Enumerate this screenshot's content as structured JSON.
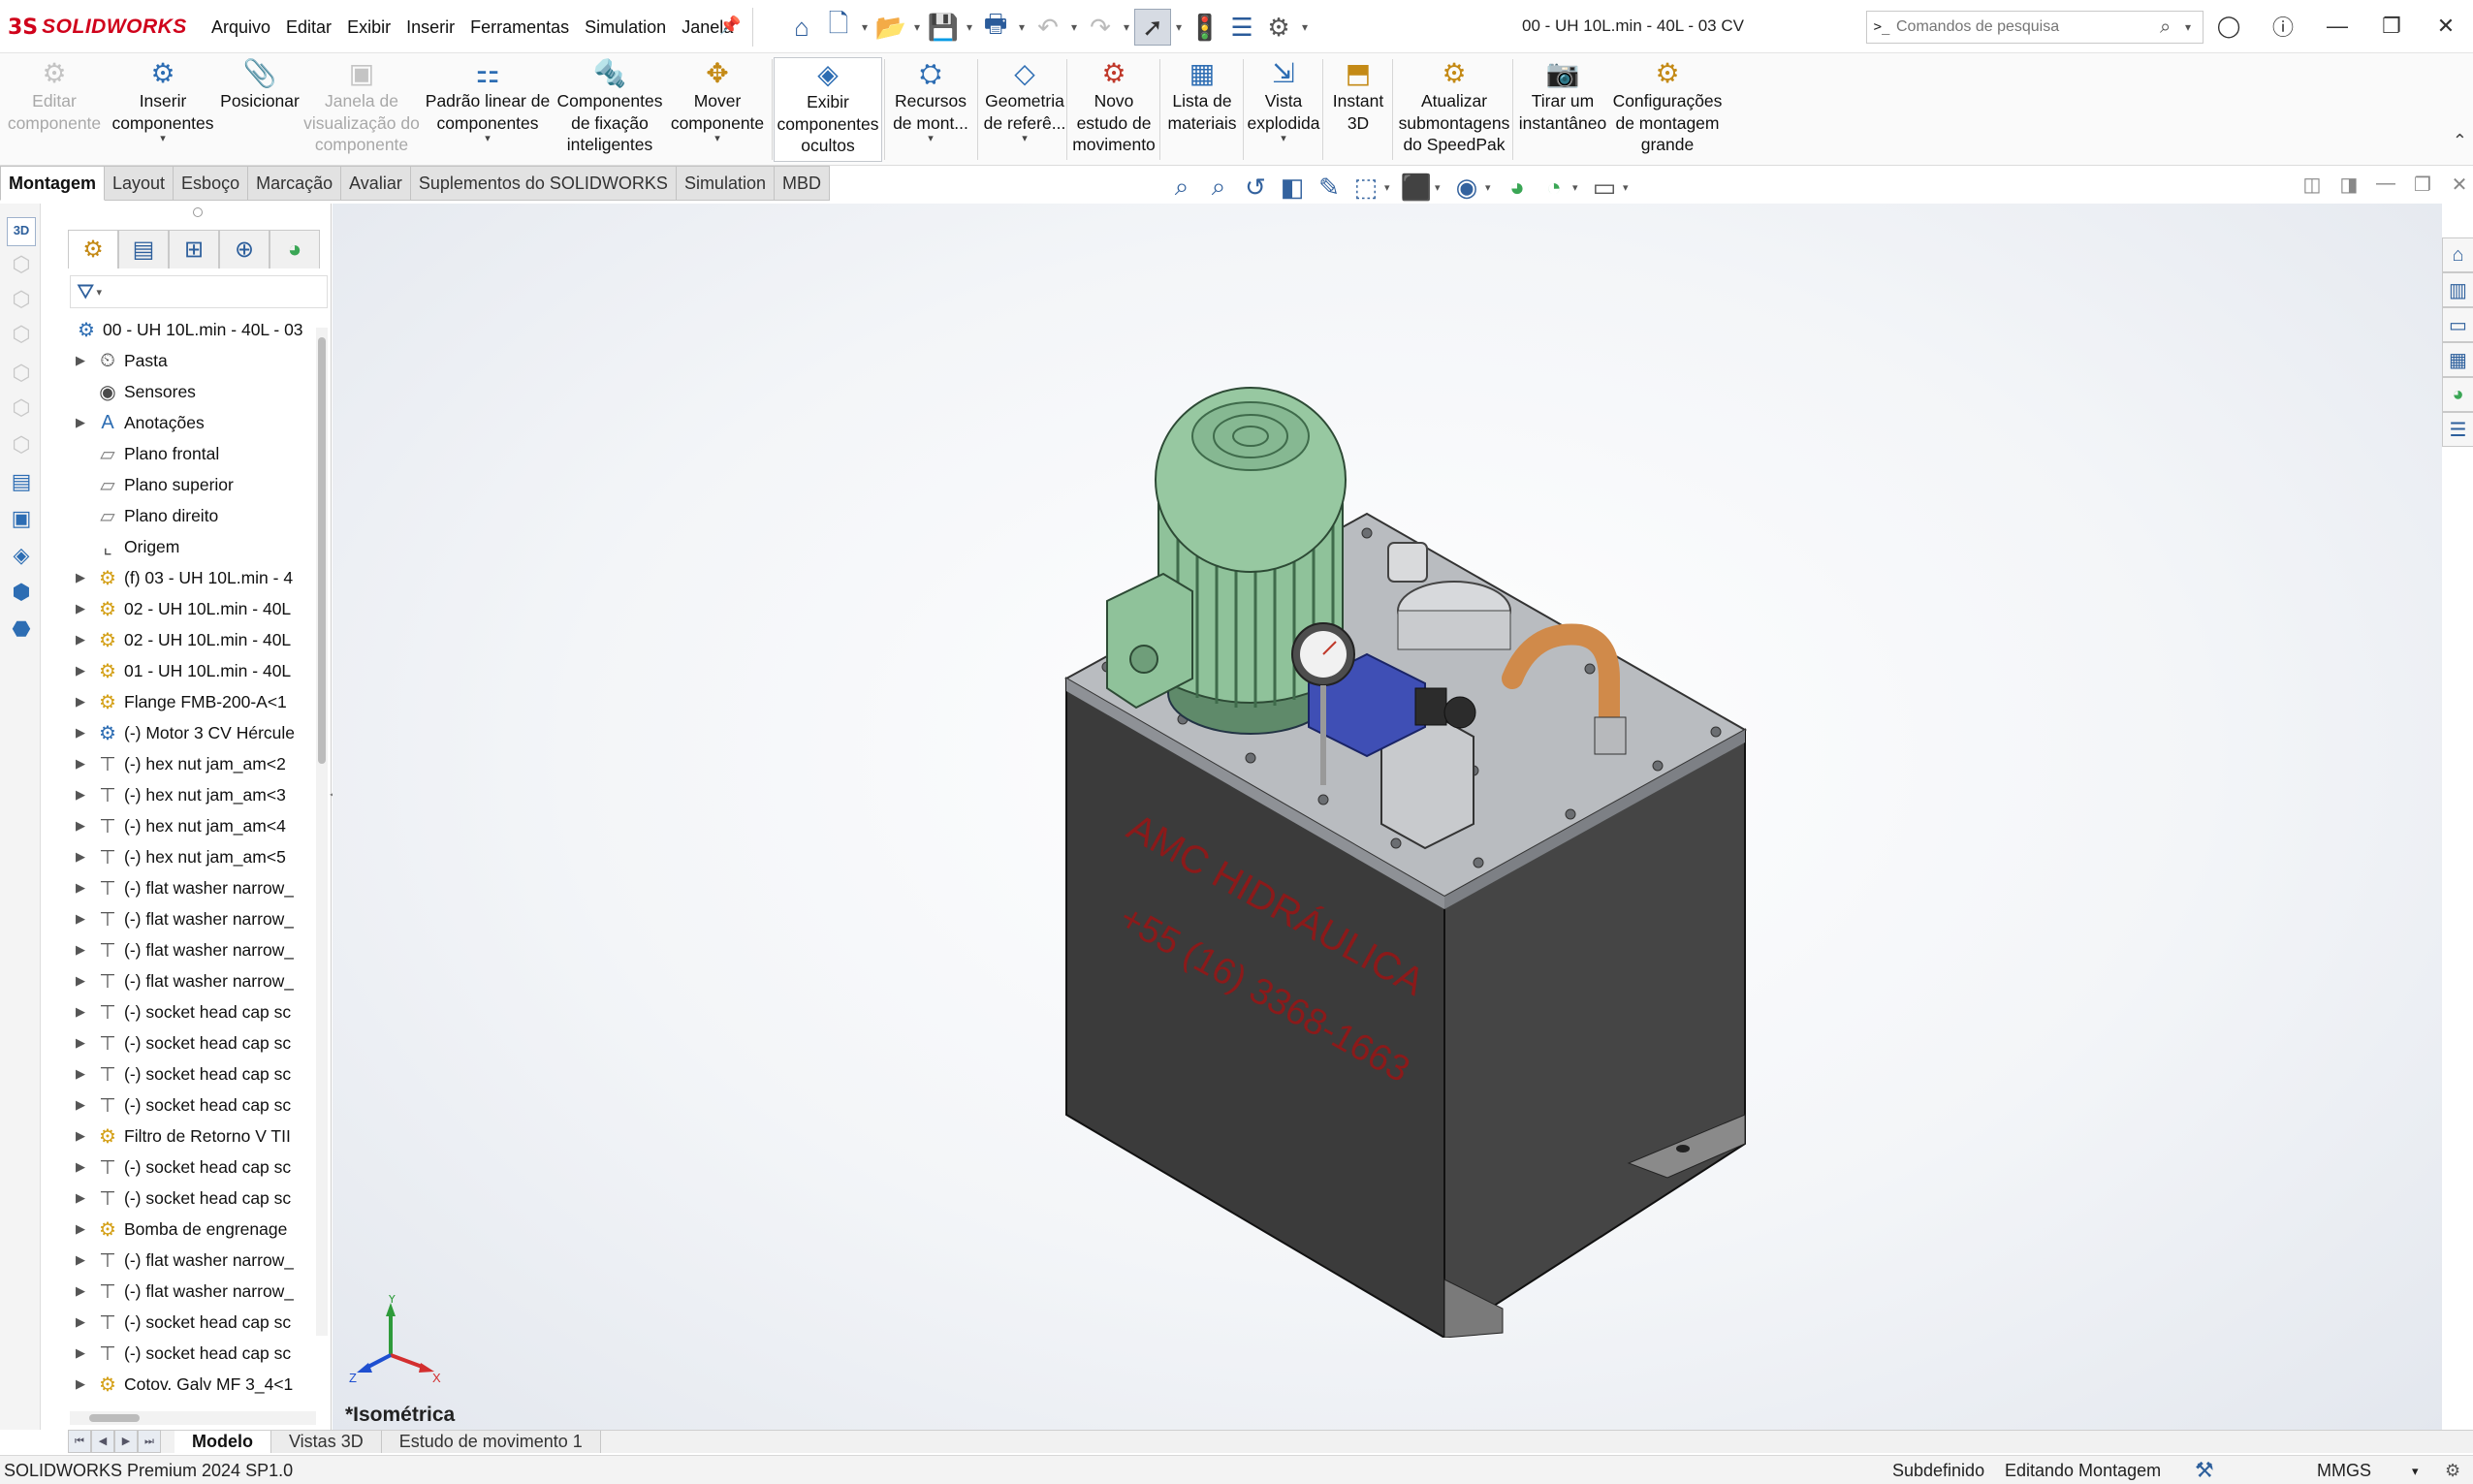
{
  "app": {
    "brand_prefix": "3S",
    "brand": "SOLIDWORKS",
    "document_title": "00 - UH 10L.min - 40L - 03 CV"
  },
  "menu": [
    "Arquivo",
    "Editar",
    "Exibir",
    "Inserir",
    "Ferramentas",
    "Simulation",
    "Janela"
  ],
  "search": {
    "placeholder": "Comandos de pesquisa",
    "prompt_glyph": ">_"
  },
  "ribbon": [
    {
      "lines": [
        "Editar",
        "componente"
      ],
      "enabled": false,
      "icon": "edit-component-icon"
    },
    {
      "lines": [
        "Inserir",
        "componentes"
      ],
      "enabled": true,
      "dropdown": true,
      "icon": "insert-components-icon"
    },
    {
      "lines": [
        "Posicionar"
      ],
      "enabled": true,
      "icon": "mate-icon"
    },
    {
      "lines": [
        "Janela de",
        "visualização do",
        "componente"
      ],
      "enabled": false,
      "icon": "component-preview-window-icon"
    },
    {
      "lines": [
        "Padrão linear de",
        "componentes"
      ],
      "enabled": true,
      "dropdown": true,
      "icon": "linear-pattern-icon"
    },
    {
      "lines": [
        "Componentes",
        "de fixação",
        "inteligentes"
      ],
      "enabled": true,
      "icon": "smart-fasteners-icon"
    },
    {
      "lines": [
        "Mover",
        "componente"
      ],
      "enabled": true,
      "dropdown": true,
      "icon": "move-component-icon"
    },
    {
      "lines": [
        "Exibir",
        "componentes",
        "ocultos"
      ],
      "enabled": true,
      "active": true,
      "icon": "show-hidden-components-icon"
    },
    {
      "lines": [
        "Recursos",
        "de mont..."
      ],
      "enabled": true,
      "dropdown": true,
      "icon": "assembly-features-icon"
    },
    {
      "lines": [
        "Geometria",
        "de referê..."
      ],
      "enabled": true,
      "dropdown": true,
      "icon": "reference-geometry-icon"
    },
    {
      "lines": [
        "Novo",
        "estudo de",
        "movimento"
      ],
      "enabled": true,
      "icon": "new-motion-study-icon"
    },
    {
      "lines": [
        "Lista de",
        "materiais"
      ],
      "enabled": true,
      "icon": "bill-of-materials-icon"
    },
    {
      "lines": [
        "Vista",
        "explodida"
      ],
      "enabled": true,
      "dropdown": true,
      "icon": "exploded-view-icon"
    },
    {
      "lines": [
        "Instant",
        "3D"
      ],
      "enabled": true,
      "icon": "instant-3d-icon"
    },
    {
      "lines": [
        "Atualizar",
        "submontagens",
        "do SpeedPak"
      ],
      "enabled": true,
      "icon": "speedpak-icon"
    },
    {
      "lines": [
        "Tirar um",
        "instantâneo"
      ],
      "enabled": true,
      "icon": "snapshot-icon"
    },
    {
      "lines": [
        "Configurações",
        "de montagem",
        "grande"
      ],
      "enabled": true,
      "icon": "large-assembly-icon"
    }
  ],
  "tabs": [
    "Montagem",
    "Layout",
    "Esboço",
    "Marcação",
    "Avaliar",
    "Suplementos do SOLIDWORKS",
    "Simulation",
    "MBD"
  ],
  "tree": [
    {
      "label": "00 - UH 10L.min - 40L - 03",
      "icon": "assembly-icon",
      "expand": false,
      "root": true
    },
    {
      "label": "Pasta",
      "icon": "history-icon",
      "expand": true
    },
    {
      "label": "Sensores",
      "icon": "sensor-icon",
      "expand": false
    },
    {
      "label": "Anotações",
      "icon": "annotation-icon",
      "expand": true
    },
    {
      "label": "Plano frontal",
      "icon": "plane-icon",
      "expand": false
    },
    {
      "label": "Plano superior",
      "icon": "plane-icon",
      "expand": false
    },
    {
      "label": "Plano direito",
      "icon": "plane-icon",
      "expand": false
    },
    {
      "label": "Origem",
      "icon": "origin-icon",
      "expand": false
    },
    {
      "label": "(f) 03 - UH 10L.min - 4",
      "icon": "subassembly-icon",
      "expand": true
    },
    {
      "label": "02 - UH 10L.min - 40L",
      "icon": "subassembly-icon",
      "expand": true
    },
    {
      "label": "02 - UH 10L.min - 40L",
      "icon": "subassembly-icon",
      "expand": true
    },
    {
      "label": "01 - UH 10L.min - 40L",
      "icon": "subassembly-icon",
      "expand": true
    },
    {
      "label": "Flange FMB-200-A<1",
      "icon": "subassembly-icon",
      "expand": true
    },
    {
      "label": "(-) Motor 3 CV Hércule",
      "icon": "part-assembly-icon",
      "expand": true
    },
    {
      "label": "(-) hex nut jam_am<2",
      "icon": "fastener-icon",
      "expand": true
    },
    {
      "label": "(-) hex nut jam_am<3",
      "icon": "fastener-icon",
      "expand": true
    },
    {
      "label": "(-) hex nut jam_am<4",
      "icon": "fastener-icon",
      "expand": true
    },
    {
      "label": "(-) hex nut jam_am<5",
      "icon": "fastener-icon",
      "expand": true
    },
    {
      "label": "(-) flat washer narrow_",
      "icon": "fastener-icon",
      "expand": true
    },
    {
      "label": "(-) flat washer narrow_",
      "icon": "fastener-icon",
      "expand": true
    },
    {
      "label": "(-) flat washer narrow_",
      "icon": "fastener-icon",
      "expand": true
    },
    {
      "label": "(-) flat washer narrow_",
      "icon": "fastener-icon",
      "expand": true
    },
    {
      "label": "(-) socket head cap sc",
      "icon": "fastener-icon",
      "expand": true
    },
    {
      "label": "(-) socket head cap sc",
      "icon": "fastener-icon",
      "expand": true
    },
    {
      "label": "(-) socket head cap sc",
      "icon": "fastener-icon",
      "expand": true
    },
    {
      "label": "(-) socket head cap sc",
      "icon": "fastener-icon",
      "expand": true
    },
    {
      "label": "Filtro de Retorno V TII",
      "icon": "subassembly-icon",
      "expand": true
    },
    {
      "label": "(-) socket head cap sc",
      "icon": "fastener-icon",
      "expand": true
    },
    {
      "label": "(-) socket head cap sc",
      "icon": "fastener-icon",
      "expand": true
    },
    {
      "label": "Bomba de engrenage",
      "icon": "subassembly-icon",
      "expand": true
    },
    {
      "label": "(-) flat washer narrow_",
      "icon": "fastener-icon",
      "expand": true
    },
    {
      "label": "(-) flat washer narrow_",
      "icon": "fastener-icon",
      "expand": true
    },
    {
      "label": "(-) socket head cap sc",
      "icon": "fastener-icon",
      "expand": true
    },
    {
      "label": "(-) socket head cap sc",
      "icon": "fastener-icon",
      "expand": true
    },
    {
      "label": "Cotov. Galv MF 3_4<1",
      "icon": "subassembly-icon",
      "expand": true
    }
  ],
  "viewport": {
    "view_name": "*Isométrica",
    "model_text_line1": "AMC HIDRÁULICA",
    "model_text_line2": "+55 (16) 3368-1663",
    "triad_axes": [
      "X",
      "Y",
      "Z"
    ]
  },
  "bottom_tabs": [
    "Modelo",
    "Vistas 3D",
    "Estudo de movimento 1"
  ],
  "status": {
    "product": "SOLIDWORKS Premium 2024 SP1.0",
    "definition": "Subdefinido",
    "mode": "Editando Montagem",
    "units": "MMGS"
  },
  "colors": {
    "brand_red": "#d0021b",
    "accent_blue": "#2d6db3",
    "motor_green": "#8fc29a",
    "tank_dark": "#3a3a3a",
    "lid_gray": "#b9bcc0",
    "engraving_red": "#8b1a1a",
    "copper": "#d08a4a"
  }
}
